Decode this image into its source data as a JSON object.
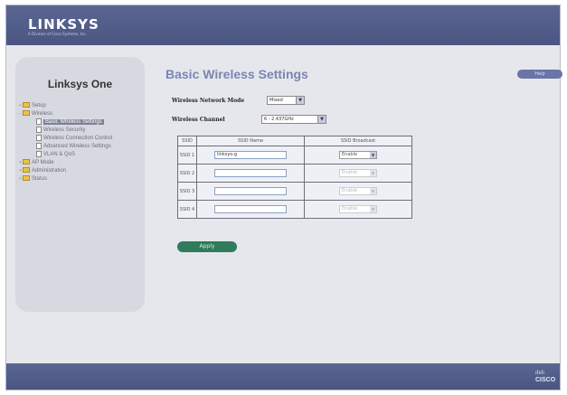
{
  "brand": {
    "logo": "LINKSYS",
    "tagline": "A Division of Cisco Systems, Inc.",
    "footer_bars": "ılıılı",
    "footer_name": "CISCO"
  },
  "sidebar": {
    "title": "Linksys One",
    "items": [
      {
        "label": "Setup",
        "type": "folder",
        "level": 0,
        "selected": false
      },
      {
        "label": "Wireless",
        "type": "folder",
        "level": 0,
        "selected": false
      },
      {
        "label": "Basic Wireless Settings",
        "type": "page",
        "level": 1,
        "selected": true
      },
      {
        "label": "Wireless Security",
        "type": "page",
        "level": 1,
        "selected": false
      },
      {
        "label": "Wireless Connection Control",
        "type": "page",
        "level": 1,
        "selected": false
      },
      {
        "label": "Advanced Wireless Settings",
        "type": "page",
        "level": 1,
        "selected": false
      },
      {
        "label": "VLAN & QoS",
        "type": "page",
        "level": 1,
        "selected": false
      },
      {
        "label": "AP Mode",
        "type": "folder",
        "level": 0,
        "selected": false
      },
      {
        "label": "Administration",
        "type": "folder",
        "level": 0,
        "selected": false
      },
      {
        "label": "Status",
        "type": "folder",
        "level": 0,
        "selected": false
      }
    ]
  },
  "main": {
    "title": "Basic Wireless Settings",
    "help_label": "Help",
    "network_mode": {
      "label": "Wireless Network Mode",
      "value": "Mixed"
    },
    "channel": {
      "label": "Wireless Channel",
      "value": "6 - 2.437GHz"
    },
    "table": {
      "headers": [
        "SSID",
        "SSID Name",
        "SSID Broadcast"
      ],
      "rows": [
        {
          "id": "SSID 1",
          "name": "linksys-g",
          "broadcast": "Enable",
          "disabled": false
        },
        {
          "id": "SSID 2",
          "name": "",
          "broadcast": "Enable",
          "disabled": true
        },
        {
          "id": "SSID 3",
          "name": "",
          "broadcast": "Enable",
          "disabled": true
        },
        {
          "id": "SSID 4",
          "name": "",
          "broadcast": "Enable",
          "disabled": true
        }
      ]
    },
    "apply_label": "Apply"
  }
}
